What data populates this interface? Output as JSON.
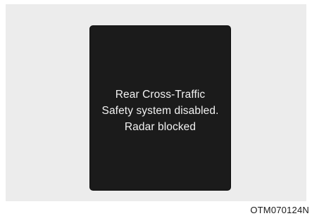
{
  "display": {
    "message_lines": [
      "Rear Cross-Traffic",
      "Safety system disabled.",
      "Radar blocked"
    ]
  },
  "figure_code": "OTM070124N"
}
